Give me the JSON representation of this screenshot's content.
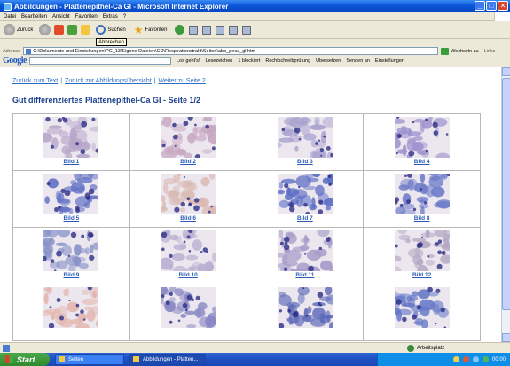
{
  "window": {
    "title": "Abbildungen - Plattenepithel-Ca GI - Microsoft Internet Explorer"
  },
  "menu": [
    "Datei",
    "Bearbeiten",
    "Ansicht",
    "Favoriten",
    "Extras",
    "?"
  ],
  "toolbar": {
    "back_label": "Zurück",
    "search_label": "Suchen",
    "favorites_label": "Favoriten",
    "tooltip": "Abbrechen"
  },
  "address": {
    "label": "Adresse",
    "value": "C:\\Dokumente und Einstellungen\\PC_13\\Eigene Dateien\\CD\\Respirationstrakt\\Seiten\\abb_peca_gl.htm",
    "go_label": "Wechseln zu",
    "links_label": "Links"
  },
  "google": {
    "logo": "Google",
    "go_label": "Los geht's!",
    "bookmarks_label": "Lesezeichen",
    "blocked_label": "1 blockiert",
    "spellcheck_label": "Rechtschreibprüfung",
    "translate_label": "Übersetzen",
    "send_label": "Senden an",
    "settings_label": "Einstellungen"
  },
  "page": {
    "nav_back_text": "Zurück zum Text",
    "nav_overview": "Zurück zur Abbildungsübersicht",
    "nav_next": "Weiter zu Seite 2",
    "title": "Gut differenziertes Plattenepithel-Ca GI - Seite 1/2",
    "images": [
      {
        "caption": "Bild 1",
        "tone": "#b7a6c9"
      },
      {
        "caption": "Bild 2",
        "tone": "#c7a8c2"
      },
      {
        "caption": "Bild 3",
        "tone": "#a9a3cf"
      },
      {
        "caption": "Bild 4",
        "tone": "#9d93cd"
      },
      {
        "caption": "Bild 5",
        "tone": "#5f6fc4"
      },
      {
        "caption": "Bild 6",
        "tone": "#d9b7b0"
      },
      {
        "caption": "Bild 7",
        "tone": "#5d6ec5"
      },
      {
        "caption": "Bild 8",
        "tone": "#6d7cc8"
      },
      {
        "caption": "Bild 9",
        "tone": "#8792c8"
      },
      {
        "caption": "Bild 10",
        "tone": "#b7aed0"
      },
      {
        "caption": "Bild 11",
        "tone": "#a69cc8"
      },
      {
        "caption": "Bild 12",
        "tone": "#b5a8c3"
      },
      {
        "caption": "",
        "tone": "#e4b4ac"
      },
      {
        "caption": "",
        "tone": "#8a88c4"
      },
      {
        "caption": "",
        "tone": "#5e6bb8"
      },
      {
        "caption": "",
        "tone": "#6578c7"
      }
    ]
  },
  "status": {
    "zone": "Arbeitsplatz"
  },
  "taskbar": {
    "start": "Start",
    "task1": "Seiten",
    "task2": "Abbildungen - Platten...",
    "clock": "00:00"
  }
}
